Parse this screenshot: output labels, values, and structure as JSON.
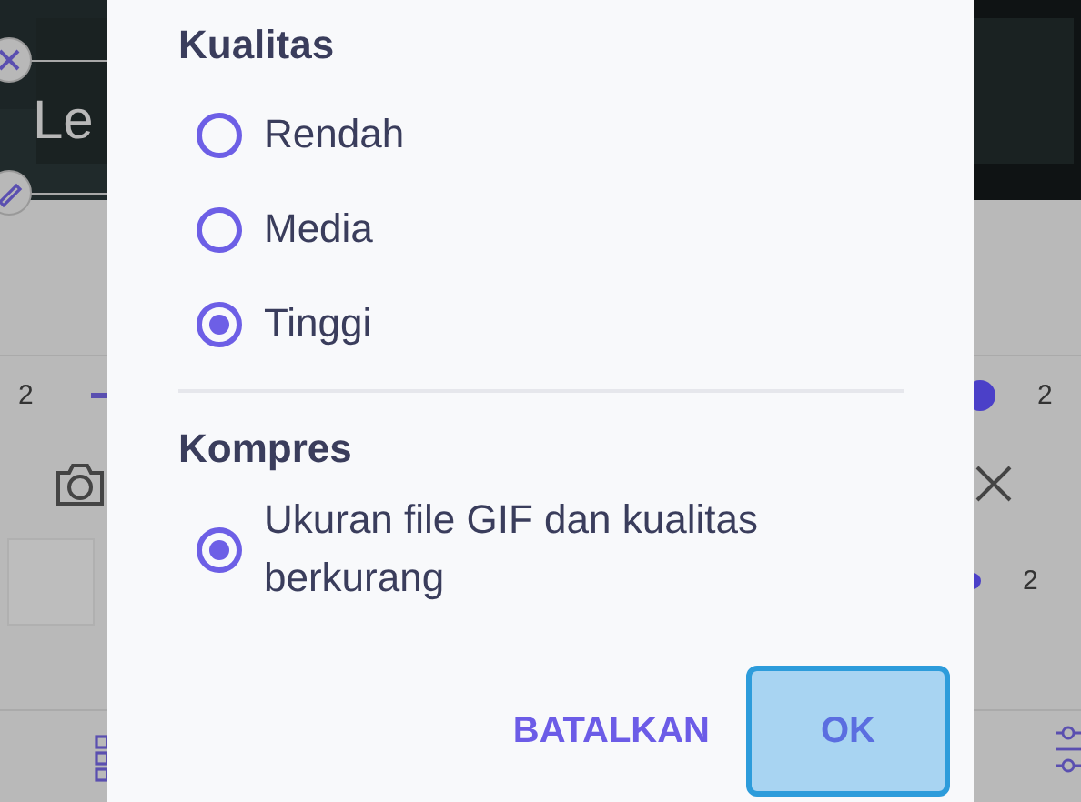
{
  "background": {
    "sticker_text": "Le",
    "values": [
      "2",
      "2",
      "2"
    ]
  },
  "dialog": {
    "sections": [
      {
        "title": "Kualitas",
        "options": [
          {
            "label": "Rendah",
            "selected": false
          },
          {
            "label": "Media",
            "selected": false
          },
          {
            "label": "Tinggi",
            "selected": true
          }
        ]
      },
      {
        "title": "Kompres",
        "options": [
          {
            "label": "Ukuran file GIF dan kualitas berkurang",
            "selected": true
          }
        ]
      }
    ],
    "buttons": [
      {
        "label": "BATALKAN",
        "kind": "text"
      },
      {
        "label": "OK",
        "kind": "focused"
      }
    ]
  }
}
